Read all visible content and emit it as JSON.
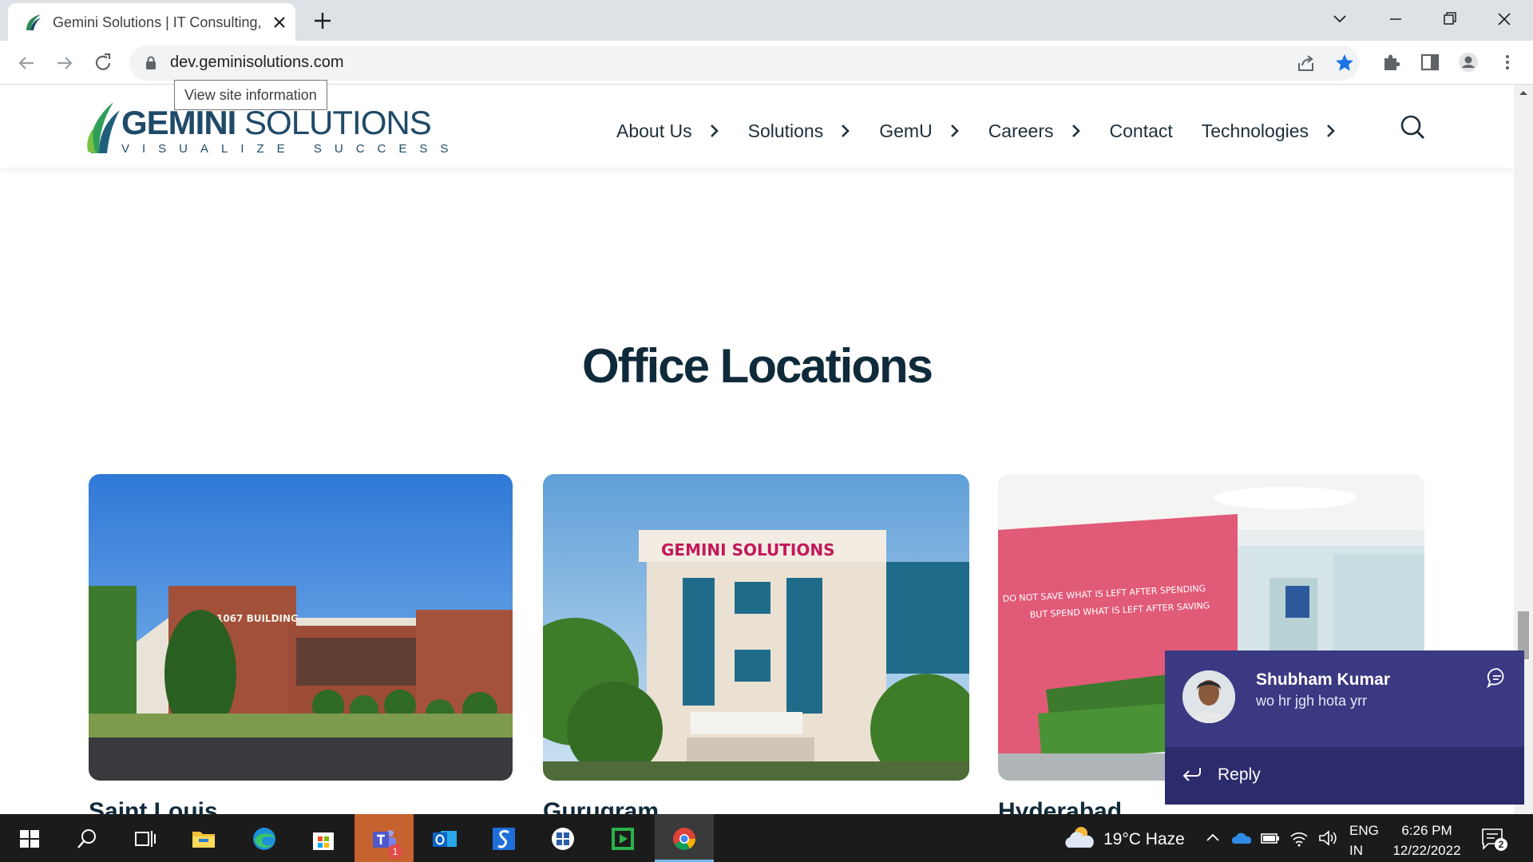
{
  "browser": {
    "tab_title": "Gemini Solutions | IT Consulting, ...",
    "url": "dev.geminisolutions.com",
    "site_info_tooltip": "View site information"
  },
  "site": {
    "logo": {
      "name_bold": "GEMINI",
      "name_rest": " SOLUTIONS",
      "tagline": "VISUALIZE SUCCESS"
    },
    "nav": [
      {
        "label": "About Us",
        "has_submenu": true
      },
      {
        "label": "Solutions",
        "has_submenu": true
      },
      {
        "label": "GemU",
        "has_submenu": true
      },
      {
        "label": "Careers",
        "has_submenu": true
      },
      {
        "label": "Contact",
        "has_submenu": false
      },
      {
        "label": "Technologies",
        "has_submenu": true
      }
    ],
    "section_title": "Office Locations",
    "offices": [
      {
        "city": "Saint Louis",
        "sign_text": "1067 BUILDING"
      },
      {
        "city": "Gurugram",
        "sign_text": "GEMINI SOLUTIONS"
      },
      {
        "city": "Hyderabad",
        "wall_quote_line1": "DO NOT SAVE WHAT IS LEFT AFTER SPENDING",
        "wall_quote_line2": "BUT SPEND WHAT IS LEFT AFTER SAVING"
      }
    ]
  },
  "notification": {
    "sender": "Shubham Kumar",
    "message": "wo hr jgh hota yrr",
    "reply_label": "Reply",
    "accent": "#3a3982"
  },
  "taskbar": {
    "weather": "19°C  Haze",
    "lang_line1": "ENG",
    "lang_line2": "IN",
    "time": "6:26 PM",
    "date": "12/22/2022",
    "notification_count": "2",
    "teams_badge": "1"
  },
  "icons": [
    "windows-start-icon",
    "search-icon",
    "task-view-icon",
    "file-explorer-icon",
    "edge-icon",
    "store-icon",
    "teams-icon",
    "outlook-icon",
    "app-s-icon",
    "app-cube-icon",
    "app-play-icon",
    "chrome-icon"
  ]
}
